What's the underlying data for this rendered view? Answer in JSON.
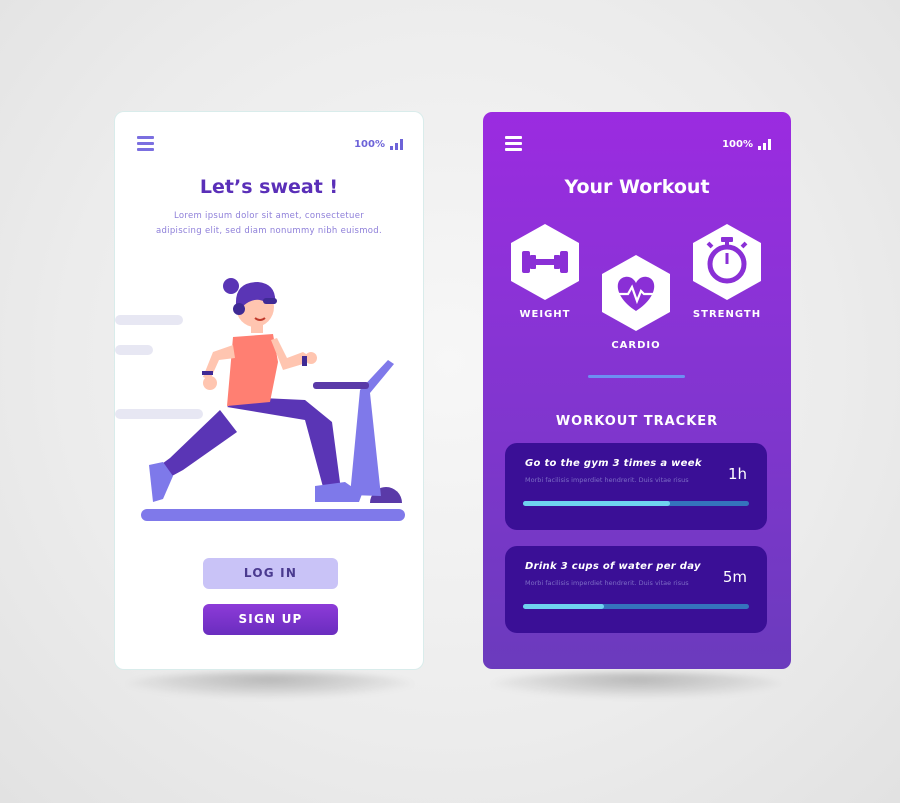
{
  "login_screen": {
    "battery": "100%",
    "title": "Let’s sweat !",
    "description_line1": "Lorem ipsum dolor sit amet, consectetuer",
    "description_line2": "adipiscing elit, sed diam nonummy nibh euismod.",
    "login_label": "LOG IN",
    "signup_label": "SIGN UP"
  },
  "workout_screen": {
    "battery": "100%",
    "title": "Your Workout",
    "categories": [
      {
        "label": "WEIGHT",
        "icon": "dumbbell-icon"
      },
      {
        "label": "CARDIO",
        "icon": "heart-pulse-icon"
      },
      {
        "label": "STRENGTH",
        "icon": "stopwatch-icon"
      }
    ],
    "tracker_title": "WORKOUT TRACKER",
    "trackers": [
      {
        "title": "Go to the gym 3 times a week",
        "subtitle": "Morbi facilisis imperdiet hendrerit. Duis vitae risus",
        "value": "1h",
        "progress": 0.65
      },
      {
        "title": "Drink 3 cups of water per day",
        "subtitle": "Morbi facilisis imperdiet hendrerit. Duis vitae risus",
        "value": "5m",
        "progress": 0.36
      }
    ]
  },
  "colors": {
    "accent_purple": "#5a2fb8",
    "login_button_bg": "#c9c3f7",
    "right_bg_top": "#9b2be0",
    "card_bg": "#3a0f96",
    "progress_fill": "#6fd3ef"
  }
}
